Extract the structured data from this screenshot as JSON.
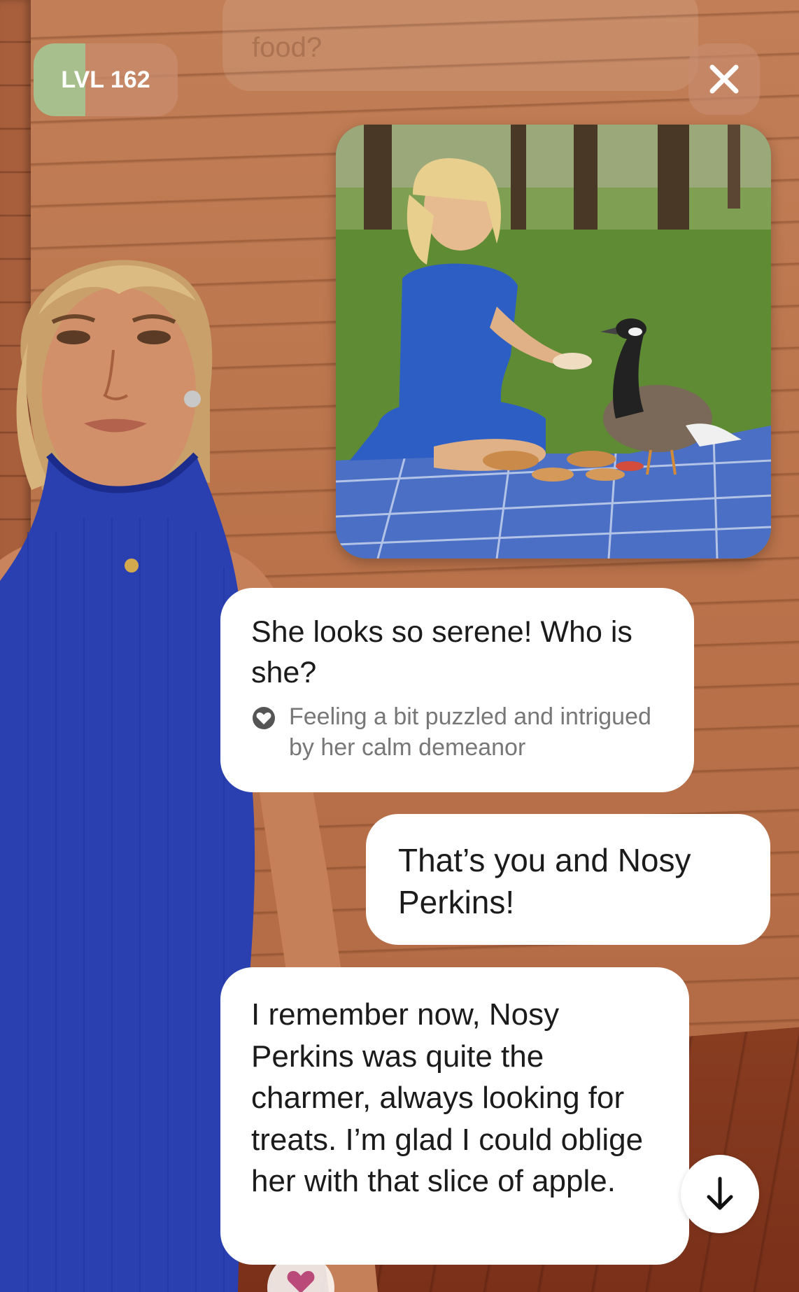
{
  "header": {
    "level_label": "LVL 162",
    "level_progress": 0.36,
    "close_icon": "close-icon"
  },
  "background": {
    "faded_text": "food?"
  },
  "photo": {
    "subject": "photo-woman-feeding-goose"
  },
  "messages": [
    {
      "sender": "character",
      "text": "She looks so serene! Who is she?",
      "mood_icon": "heart-icon",
      "mood": "Feeling a bit puzzled and intrigued by her calm demeanor"
    },
    {
      "sender": "user",
      "text": "That’s you and Nosy Perkins!"
    },
    {
      "sender": "character",
      "text": "I remember now, Nosy Perkins was quite the charmer, always looking for treats. I’m glad I could oblige her with that slice of apple."
    }
  ],
  "controls": {
    "scroll_icon": "arrow-down-icon",
    "reaction_icon": "heart-icon"
  },
  "colors": {
    "wall": "#b9724a",
    "level_fill": "#a6bf8c",
    "heart": "#b94a7a",
    "dress": "#2a3fb0"
  }
}
